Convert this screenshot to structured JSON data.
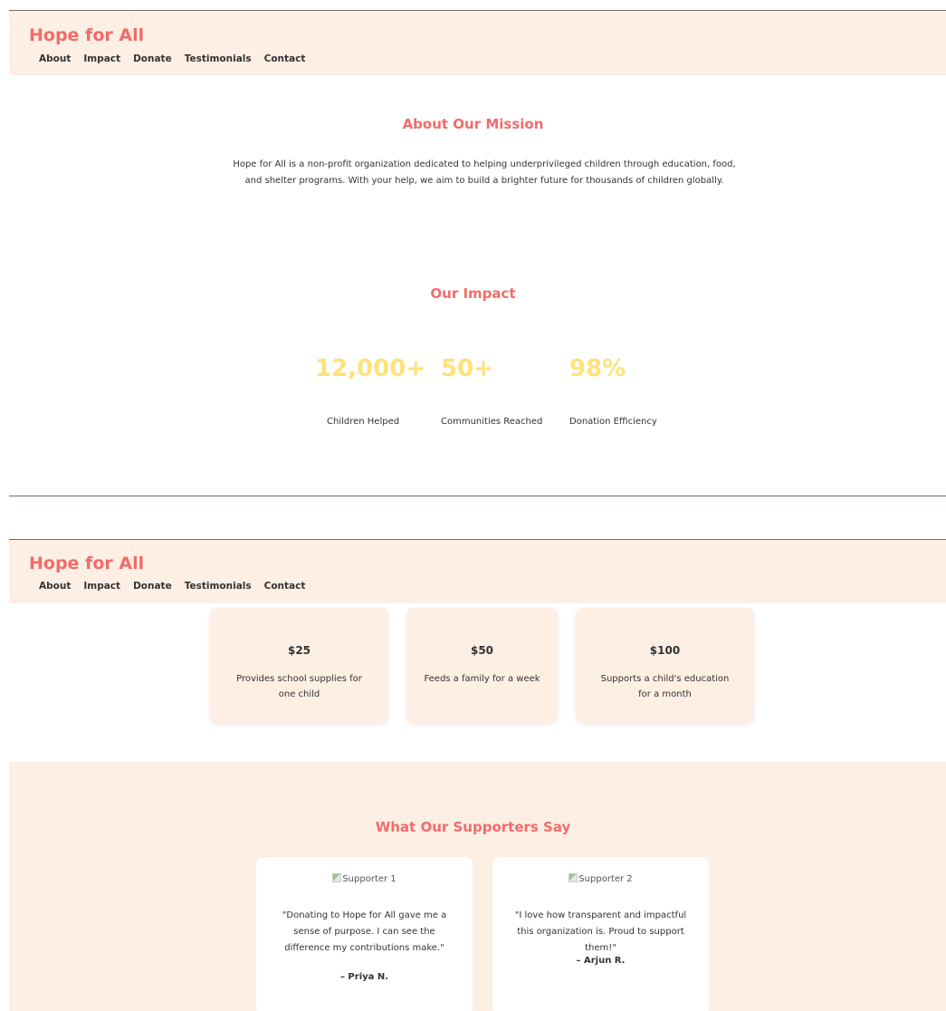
{
  "brand": {
    "name": "Hope for All",
    "color": "#f26b6b"
  },
  "nav": {
    "items": [
      "About",
      "Impact",
      "Donate",
      "Testimonials",
      "Contact"
    ]
  },
  "colors": {
    "header_bg": "#fdefe4",
    "accent": "#f26b6b",
    "stat_highlight": "#ffe27a",
    "card_bg": "#fdefe4"
  },
  "about": {
    "title": "About Our Mission",
    "text": "Hope for All is a non-profit organization dedicated to helping underprivileged children through education, food, and shelter programs. With your help, we aim to build a brighter future for thousands of children globally."
  },
  "impact": {
    "title": "Our Impact",
    "stats": [
      {
        "value": "12,000+",
        "label": "Children Helped"
      },
      {
        "value": "50+",
        "label": "Communities Reached"
      },
      {
        "value": "98%",
        "label": "Donation Efficiency"
      }
    ]
  },
  "donate": {
    "tiers": [
      {
        "amount": "$25",
        "description": "Provides school supplies for one child"
      },
      {
        "amount": "$50",
        "description": "Feeds a family for a week"
      },
      {
        "amount": "$100",
        "description": "Supports a child's education for a month"
      }
    ]
  },
  "testimonials": {
    "title": "What Our Supporters Say",
    "items": [
      {
        "image_alt": "Supporter 1",
        "quote": "\"Donating to Hope for All gave me a sense of purpose. I can see the difference my contributions make.\"",
        "author": "– Priya N."
      },
      {
        "image_alt": "Supporter 2",
        "quote": "\"I love how transparent and impactful this organization is. Proud to support them!\"",
        "author": "– Arjun R."
      }
    ]
  }
}
